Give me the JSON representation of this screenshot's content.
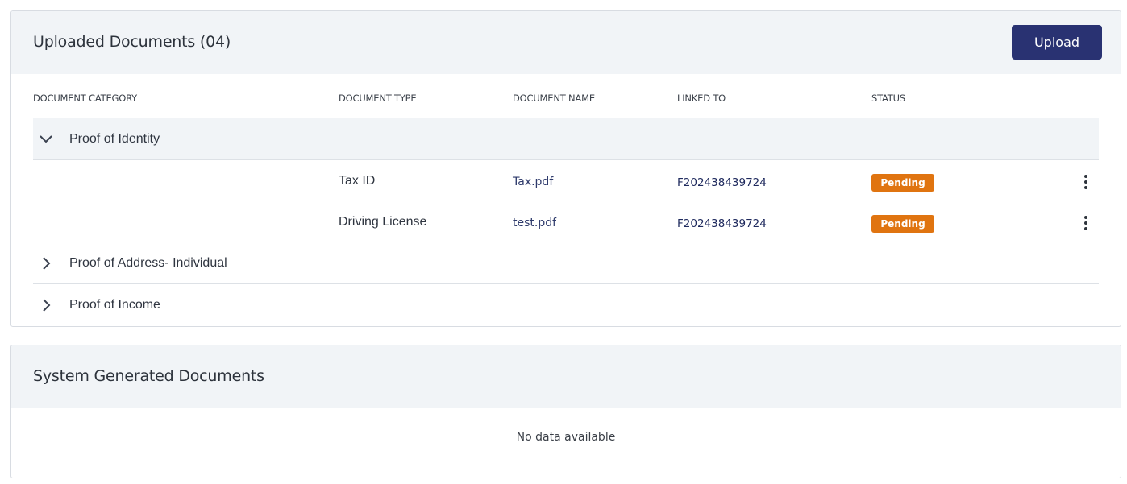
{
  "uploaded": {
    "title": "Uploaded Documents (04)",
    "upload_label": "Upload",
    "columns": [
      "DOCUMENT CATEGORY",
      "DOCUMENT TYPE",
      "DOCUMENT NAME",
      "LINKED TO",
      "STATUS"
    ],
    "groups": [
      {
        "label": "Proof of Identity",
        "expanded": true,
        "icon": "chevron-down-icon",
        "rows": [
          {
            "type": "Tax ID",
            "name": "Tax.pdf",
            "linked": "F202438439724",
            "status": "Pending"
          },
          {
            "type": "Driving License",
            "name": "test.pdf",
            "linked": "F202438439724",
            "status": "Pending"
          }
        ]
      },
      {
        "label": "Proof of Address- Individual",
        "expanded": false,
        "icon": "chevron-right-icon"
      },
      {
        "label": "Proof of Income",
        "expanded": false,
        "icon": "chevron-right-icon"
      }
    ]
  },
  "system": {
    "title": "System Generated Documents",
    "empty_text": "No data available"
  },
  "colors": {
    "header_bg": "#f1f4f7",
    "button_bg": "#293272",
    "pending_badge": "#e07410",
    "link_text": "#2e3a6b"
  }
}
